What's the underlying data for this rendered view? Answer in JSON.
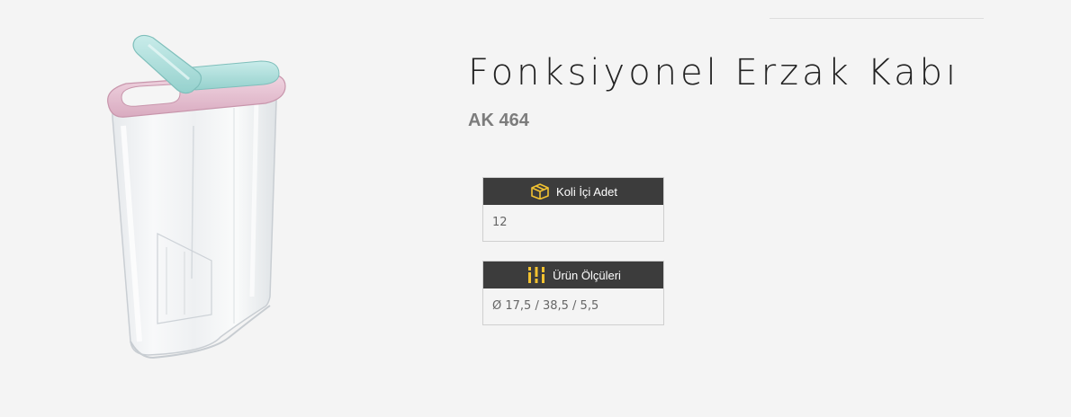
{
  "product": {
    "title": "Fonksiyonel Erzak Kabı",
    "code": "AK 464",
    "image_alt": "transparent container with pink rim and mint flip lid"
  },
  "specs": [
    {
      "label": "Koli İçi Adet",
      "icon": "box-icon",
      "value": "12"
    },
    {
      "label": "Ürün Ölçüleri",
      "icon": "dimensions-icon",
      "value": "Ø 17,5 / 38,5 / 5,5"
    }
  ],
  "colors": {
    "page_background": "#f4f4f4",
    "spec_header_background": "#3c3c3c",
    "icon_accent": "#f2c230",
    "lid_mint": "#a8dcd9",
    "rim_pink": "#e8c3d3"
  }
}
